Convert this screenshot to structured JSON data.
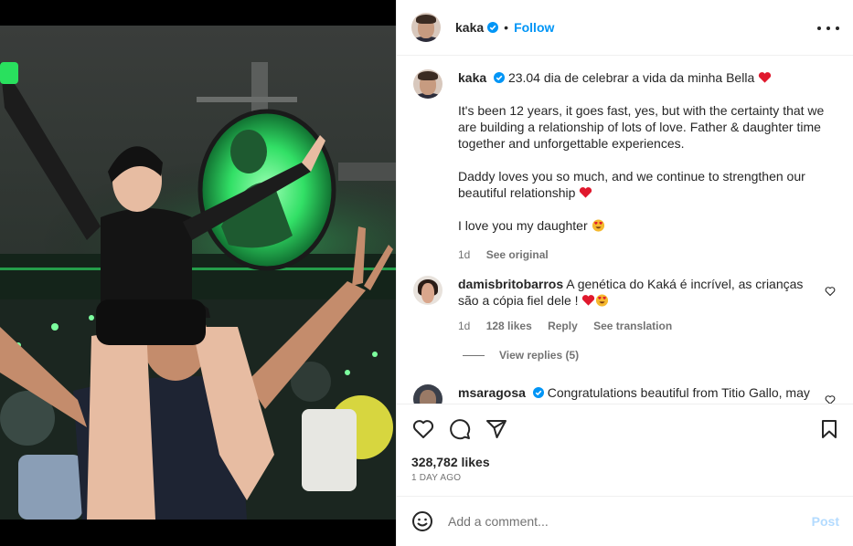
{
  "post": {
    "author": "kaka",
    "follow_label": "Follow",
    "caption_lead": "23.04 dia de celebrar a vida da minha Bella",
    "caption_p1": "It's been 12 years, it goes fast, yes, but with the certainty that we are building a relationship of lots of love. Father & daughter time together and unforgettable experiences.",
    "caption_p2": "Daddy loves you so much, and we continue to strengthen our beautiful relationship",
    "caption_p3": "I love you my daughter",
    "caption_time": "1d",
    "see_original": "See original",
    "likes": "328,782 likes",
    "date": "1 DAY AGO"
  },
  "comments": [
    {
      "user": "damisbritobarros",
      "text": "A genética do Kaká é incrível, as crianças são a cópia fiel dele !",
      "time": "1d",
      "likes": "128 likes",
      "reply": "Reply",
      "translate": "See translation",
      "view_replies": "View replies (5)"
    },
    {
      "user": "msaragosa",
      "text": "Congratulations beautiful from Titio Gallo, may"
    }
  ],
  "add_comment": {
    "placeholder": "Add a comment...",
    "post_label": "Post"
  },
  "icons": {
    "like": "heart-icon",
    "comment": "comment-icon",
    "share": "send-icon",
    "save": "bookmark-icon",
    "emoji": "smiley-icon",
    "more": "more-icon",
    "verified": "verified-badge-icon"
  },
  "colors": {
    "accent": "#0095f6",
    "post_disabled": "#b3dbff",
    "muted": "#737373",
    "stage_green": "#39e86a"
  }
}
